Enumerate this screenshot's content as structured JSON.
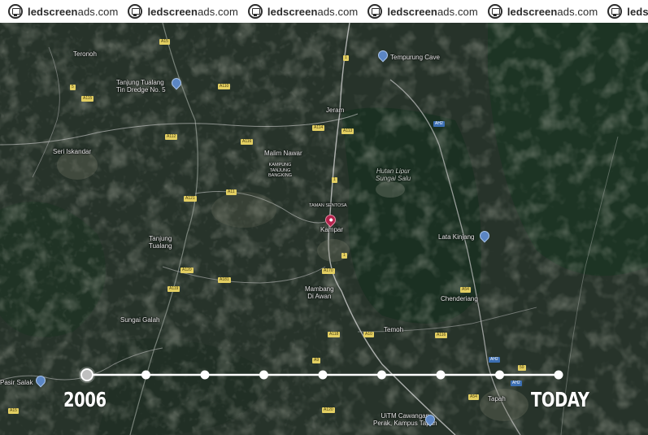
{
  "banner": {
    "brand_bold": "ledscreen",
    "brand_light": "ads.com",
    "repeat": 6,
    "logo_icon": "monitor-circle-icon"
  },
  "places": {
    "teronoh": "Teronoh",
    "tanjung_tualang_dredge": "Tanjung Tualang\nTin Dredge No. 5",
    "tempurung_cave": "Tempurung Cave",
    "jeram": "Jeram",
    "seri_iskandar": "Seri Iskandar",
    "malim_nawar": "Malim Nawar",
    "kampung_tanjung": "KAMPUNG\nTANJUNG\nBANGKING",
    "hutan_lipur": "Hutan Lipur\nSungai Salu",
    "taman_sentosa": "TAMAN SENTOSA",
    "kampar": "Kampar",
    "lata_kinjang": "Lata Kinjang",
    "tanjung_tualang": "Tanjung\nTualang",
    "mambang": "Mambang\nDi Awan",
    "chenderiang": "Chenderiang",
    "sungai_galah": "Sungai Galah",
    "temoh": "Temoh",
    "pasir_salak": "Pasir Salak",
    "tapah": "Tapah",
    "uitm": "UiTM Cawangan\nPerak, Kampus Tapah"
  },
  "roads": {
    "a15": "A15",
    "r1": "1",
    "r5": "5",
    "a115": "A115",
    "a110": "A110",
    "a112": "A112",
    "a114": "A114",
    "a113": "A113",
    "a116": "A116",
    "ah2": "AH2",
    "r59": "59",
    "a11": "A11",
    "a121": "A121",
    "a181": "A181",
    "a120": "A120",
    "a119": "A119",
    "a170": "A170",
    "a118": "A118",
    "a10": "A10",
    "a54": "A54",
    "a9": "A9"
  },
  "timeline": {
    "start_label": "2006",
    "end_label": "TODAY",
    "dot_count": 9,
    "active_index": 0
  },
  "colors": {
    "map_base": "#1e2a22",
    "forest": "#1c3523",
    "timeline": "#ffffff",
    "active_dot": "#bfbfbf",
    "marker": "#b3234c",
    "poi": "#5b86c4"
  }
}
